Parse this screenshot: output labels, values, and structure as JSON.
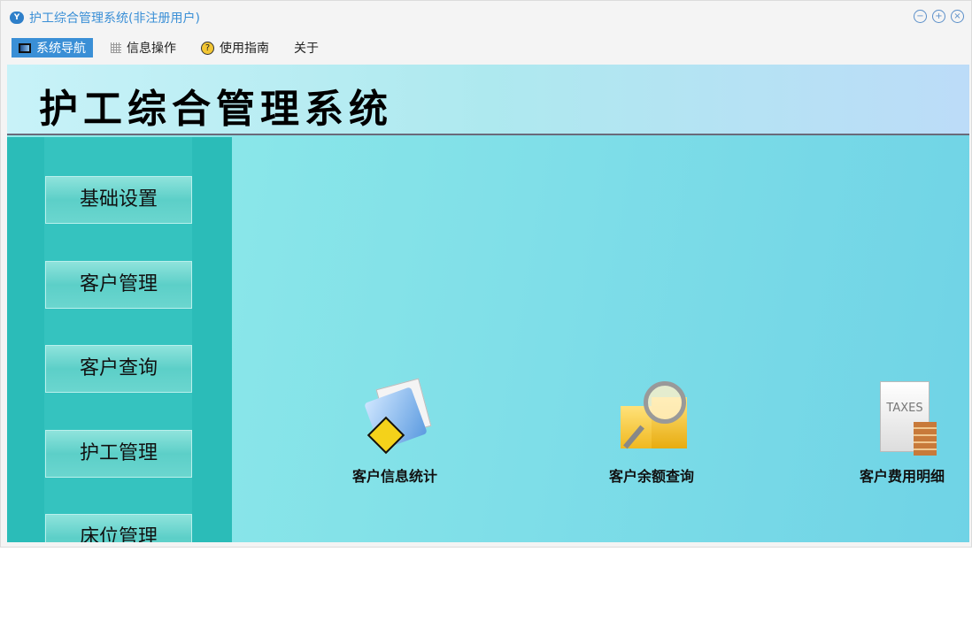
{
  "window": {
    "title": "护工综合管理系统(非注册用户)",
    "controls": [
      "minimize",
      "maximize",
      "close"
    ]
  },
  "menu": [
    {
      "label": "系统导航",
      "icon": "window-icon",
      "active": true
    },
    {
      "label": "信息操作",
      "icon": "grid-icon"
    },
    {
      "label": "使用指南",
      "icon": "help-icon"
    },
    {
      "label": "关于"
    }
  ],
  "header": {
    "title": "护工综合管理系统"
  },
  "sidebar": [
    "基础设置",
    "客户管理",
    "客户查询",
    "护工管理",
    "床位管理"
  ],
  "tiles": [
    {
      "label": "客户信息统计",
      "icon": "folder-walker-icon"
    },
    {
      "label": "客户余额查询",
      "icon": "coins-magnifier-icon"
    },
    {
      "label": "客户费用明细",
      "icon": "taxes-document-icon",
      "icon_text": "TAXES"
    }
  ]
}
